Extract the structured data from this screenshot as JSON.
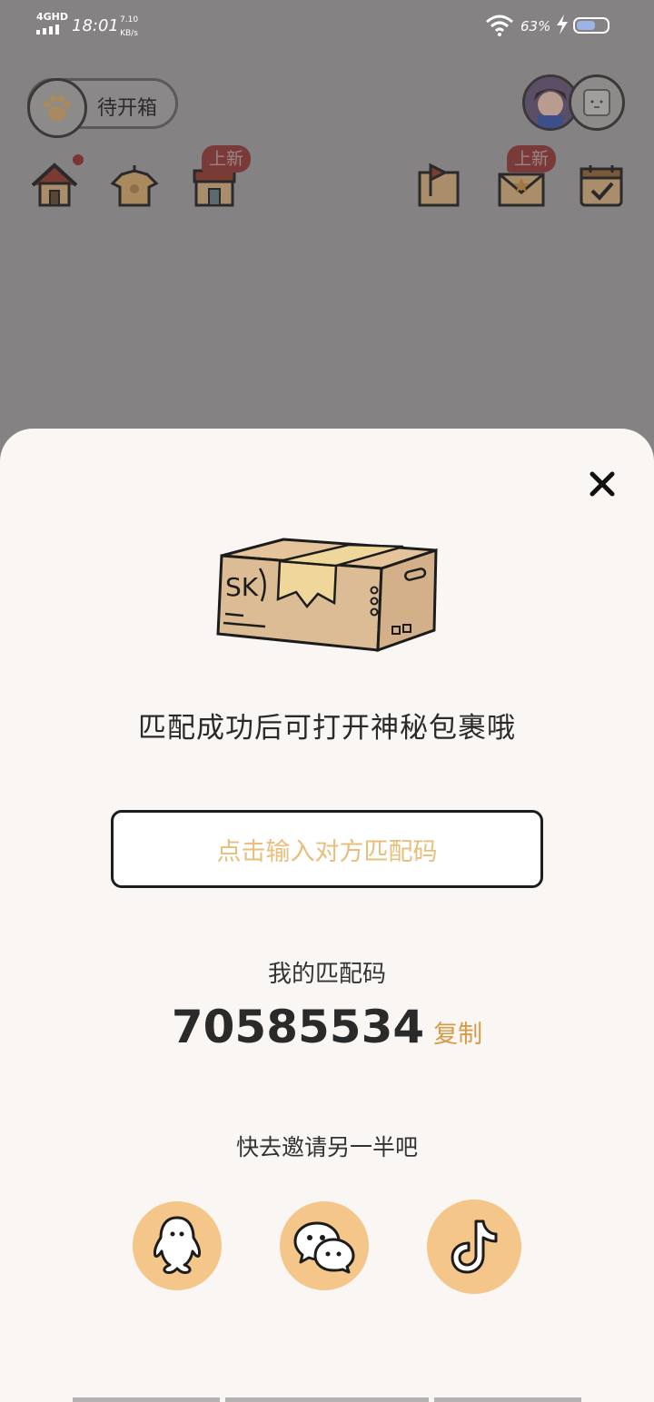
{
  "status_bar": {
    "network": "4GHD",
    "time": "18:01",
    "speed_value": "7.10",
    "speed_unit": "KB/s",
    "battery": "63%",
    "battery_level": 0.63
  },
  "header": {
    "unbox_label": "待开箱"
  },
  "nav": {
    "new_badge_left": "上新",
    "new_badge_right": "上新"
  },
  "sheet": {
    "title": "匹配成功后可打开神秘包裹哦",
    "input_placeholder": "点击输入对方匹配码",
    "my_code_label": "我的匹配码",
    "my_code": "70585534",
    "copy_label": "复制",
    "invite_label": "快去邀请另一半吧",
    "share_buttons": [
      "qq-icon",
      "wechat-icon",
      "tiktok-icon"
    ]
  },
  "colors": {
    "accent": "#f4c68a",
    "placeholder": "#e9be7a",
    "copy": "#d79b46",
    "dim_overlay": "#858283"
  }
}
